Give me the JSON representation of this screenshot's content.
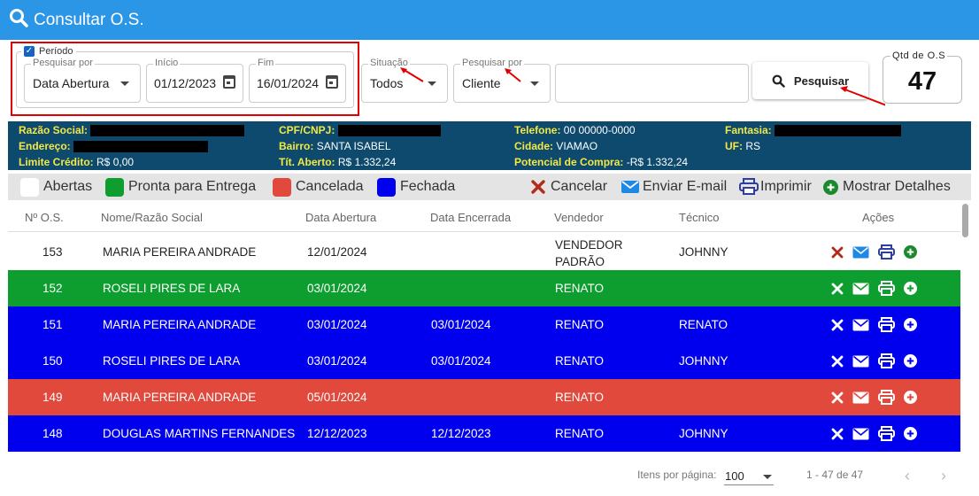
{
  "title": "Consultar O.S.",
  "filters": {
    "period_label": "Período",
    "pesquisar_por_label": "Pesquisar por",
    "pesquisar_por_value": "Data Abertura",
    "inicio_label": "Início",
    "inicio_value": "01/12/2023",
    "fim_label": "Fim",
    "fim_value": "16/01/2024",
    "situacao_label": "Situação",
    "situacao_value": "Todos",
    "pesquisar_por2_label": "Pesquisar por",
    "pesquisar_por2_value": "Cliente",
    "search_value": "",
    "search_button": "Pesquisar",
    "qtd_label": "Qtd de O.S",
    "qtd_value": "47"
  },
  "info": {
    "razao_label": "Razão Social:",
    "endereco_label": "Endereço:",
    "limite_label": "Limite Crédito:",
    "limite_value": "R$ 0,00",
    "cpf_label": "CPF/CNPJ:",
    "bairro_label": "Bairro:",
    "bairro_value": "SANTA ISABEL",
    "tit_label": "Tít. Aberto:",
    "tit_value": "R$ 1.332,24",
    "telefone_label": "Telefone:",
    "telefone_value": "00 00000-0000",
    "cidade_label": "Cidade:",
    "cidade_value": "VIAMAO",
    "potencial_label": "Potencial de Compra:",
    "potencial_value": "-R$ 1.332,24",
    "fantasia_label": "Fantasia:",
    "uf_label": "UF:",
    "uf_value": "RS"
  },
  "legend": {
    "abertas": "Abertas",
    "pronta": "Pronta para Entrega",
    "cancelada": "Cancelada",
    "fechada": "Fechada",
    "cancelar": "Cancelar",
    "enviar": "Enviar E-mail",
    "imprimir": "Imprimir",
    "detalhes": "Mostrar Detalhes"
  },
  "colors": {
    "aberta": "#ffffff",
    "pronta": "#0e9e2f",
    "cancelada": "#e0493b",
    "fechada": "#0000ee",
    "header": "#2c96e6",
    "infobar": "#0d4a6e"
  },
  "table": {
    "headers": [
      "Nº O.S.",
      "Nome/Razão Social",
      "Data Abertura",
      "Data Encerrada",
      "Vendedor",
      "Técnico",
      "Ações"
    ],
    "rows": [
      {
        "os": "153",
        "nome": "MARIA PEREIRA ANDRADE",
        "abertura": "12/01/2024",
        "encerrada": "",
        "vendedor1": "VENDEDOR",
        "vendedor2": "PADRÃO",
        "tecnico": "JOHNNY",
        "status": "aberta"
      },
      {
        "os": "152",
        "nome": "ROSELI PIRES DE LARA",
        "abertura": "03/01/2024",
        "encerrada": "",
        "vendedor1": "RENATO",
        "vendedor2": "",
        "tecnico": "",
        "status": "pronta"
      },
      {
        "os": "151",
        "nome": "MARIA PEREIRA ANDRADE",
        "abertura": "03/01/2024",
        "encerrada": "03/01/2024",
        "vendedor1": "RENATO",
        "vendedor2": "",
        "tecnico": "RENATO",
        "status": "fechada"
      },
      {
        "os": "150",
        "nome": "ROSELI PIRES DE LARA",
        "abertura": "03/01/2024",
        "encerrada": "03/01/2024",
        "vendedor1": "RENATO",
        "vendedor2": "",
        "tecnico": "JOHNNY",
        "status": "fechada"
      },
      {
        "os": "149",
        "nome": "MARIA PEREIRA ANDRADE",
        "abertura": "05/01/2024",
        "encerrada": "",
        "vendedor1": "RENATO",
        "vendedor2": "",
        "tecnico": "",
        "status": "cancelada"
      },
      {
        "os": "148",
        "nome": "DOUGLAS MARTINS FERNANDES",
        "abertura": "12/12/2023",
        "encerrada": "12/12/2023",
        "vendedor1": "RENATO",
        "vendedor2": "",
        "tecnico": "JOHNNY",
        "status": "fechada"
      }
    ]
  },
  "footer": {
    "itens_label": "Itens por página:",
    "itens_value": "100",
    "range": "1 - 47 de 47"
  }
}
